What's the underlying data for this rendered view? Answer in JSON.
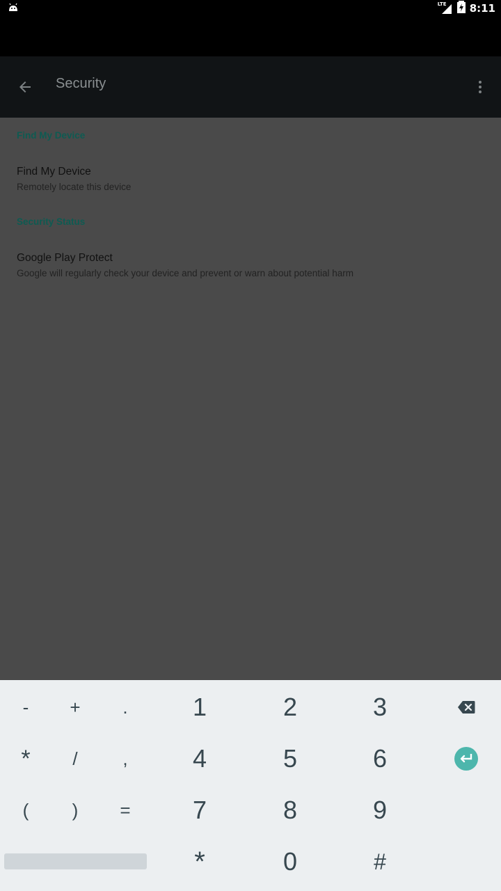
{
  "status_bar": {
    "time": "8:11",
    "network": "LTE",
    "icons": [
      "android-icon",
      "signal-icon",
      "battery-charging-icon"
    ]
  },
  "app_bar": {
    "title": "Security",
    "back_icon": "arrow-back-icon",
    "menu_icon": "more-vert-icon"
  },
  "sections": [
    {
      "header": "Find My Device",
      "items": [
        {
          "title": "Find My Device",
          "subtitle": "Remotely locate this device"
        }
      ]
    },
    {
      "header": "Security Status",
      "items": [
        {
          "title": "Google Play Protect",
          "subtitle": "Google will regularly check your device and prevent or warn about potential harm"
        }
      ]
    }
  ],
  "keyboard": {
    "rows": [
      [
        "-",
        "+",
        ".",
        "1",
        "2",
        "3",
        "backspace"
      ],
      [
        "*",
        "/",
        ",",
        "4",
        "5",
        "6",
        "enter"
      ],
      [
        "(",
        ")",
        "=",
        "7",
        "8",
        "9",
        ""
      ],
      [
        "space",
        "*",
        "0",
        "#"
      ]
    ],
    "accent_color": "#4db6ac",
    "symbol_keys": {
      "r1": [
        "-",
        "+",
        "."
      ],
      "r2": [
        "*",
        "/",
        ","
      ],
      "r3": [
        "(",
        ")",
        "="
      ]
    },
    "number_keys": {
      "r1": [
        "1",
        "2",
        "3"
      ],
      "r2": [
        "4",
        "5",
        "6"
      ],
      "r3": [
        "7",
        "8",
        "9"
      ],
      "r4": [
        "*",
        "0",
        "#"
      ]
    }
  },
  "colors": {
    "status_bar": "#000000",
    "app_bar": "#111416",
    "scrim_background": "#4a4a4a",
    "section_header": "#0e5b52",
    "keyboard_bg": "#eceff1",
    "key_text": "#37474f"
  }
}
